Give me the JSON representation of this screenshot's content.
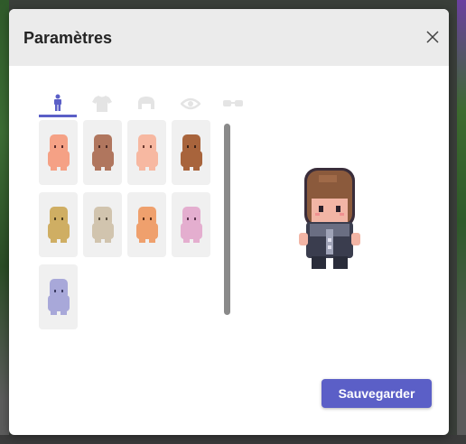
{
  "dialog": {
    "title": "Paramètres",
    "save_label": "Sauvegarder"
  },
  "tabs": [
    {
      "icon": "body-icon",
      "active": true
    },
    {
      "icon": "shirt-icon",
      "active": false
    },
    {
      "icon": "hair-icon",
      "active": false
    },
    {
      "icon": "eye-icon",
      "active": false
    },
    {
      "icon": "glasses-icon",
      "active": false
    }
  ],
  "skins": [
    {
      "name": "skin-peach",
      "color": "#f5a185"
    },
    {
      "name": "skin-brown",
      "color": "#b0765e"
    },
    {
      "name": "skin-light-peach",
      "color": "#f7b8a1"
    },
    {
      "name": "skin-dark-brown",
      "color": "#a8643c"
    },
    {
      "name": "skin-gold",
      "color": "#cfae63"
    },
    {
      "name": "skin-beige",
      "color": "#d1c4ae"
    },
    {
      "name": "skin-orange",
      "color": "#efa06d"
    },
    {
      "name": "skin-pink",
      "color": "#e4aecf"
    },
    {
      "name": "skin-lavender",
      "color": "#a8a8d9"
    }
  ],
  "colors": {
    "accent": "#5b5fc7",
    "header_bg": "#ebebeb"
  }
}
